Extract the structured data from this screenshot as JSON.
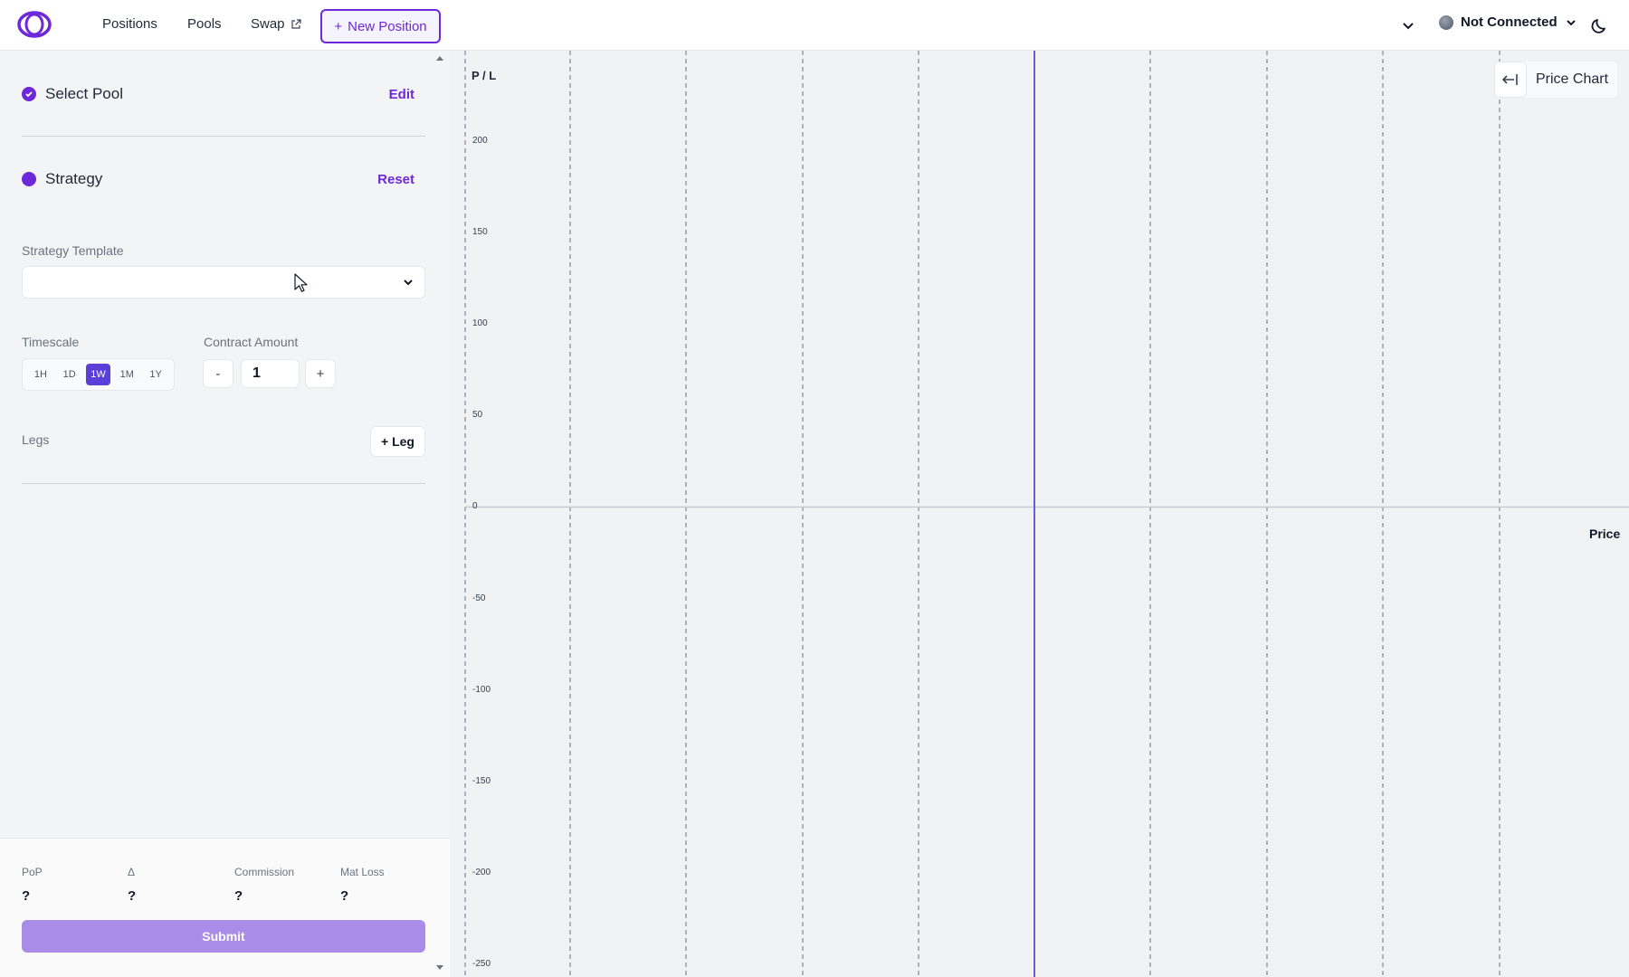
{
  "header": {
    "nav": {
      "positions": "Positions",
      "pools": "Pools",
      "swap": "Swap"
    },
    "new_position": "New Position",
    "connection_status": "Not Connected"
  },
  "panel": {
    "select_pool": {
      "title": "Select Pool",
      "action": "Edit"
    },
    "strategy": {
      "title": "Strategy",
      "action": "Reset"
    },
    "strategy_template_label": "Strategy Template",
    "strategy_template_value": "",
    "timescale_label": "Timescale",
    "timescale_options": [
      "1H",
      "1D",
      "1W",
      "1M",
      "1Y"
    ],
    "timescale_selected": "1W",
    "contract_amount_label": "Contract Amount",
    "contract_amount": "1",
    "minus": "-",
    "plus": "+",
    "legs_label": "Legs",
    "add_leg": "+ Leg"
  },
  "summary": {
    "pop_label": "PoP",
    "delta_label": "Δ",
    "commission_label": "Commission",
    "max_loss_label": "Mat Loss",
    "pop_value": "?",
    "delta_value": "?",
    "commission_value": "?",
    "max_loss_value": "?",
    "submit": "Submit"
  },
  "chart_data": {
    "type": "line",
    "ylabel": "P / L",
    "xlabel": "Price",
    "y_ticks": [
      "200",
      "150",
      "100",
      "50",
      "0",
      "-50",
      "-100",
      "-150",
      "-200",
      "-250"
    ],
    "ylim": [
      -250,
      225
    ],
    "series": [],
    "grid": true,
    "toggle_label": "Price Chart"
  },
  "colors": {
    "accent": "#6d28d9",
    "current_price_line": "#6d5dd3",
    "submit_disabled": "#a98be8"
  }
}
